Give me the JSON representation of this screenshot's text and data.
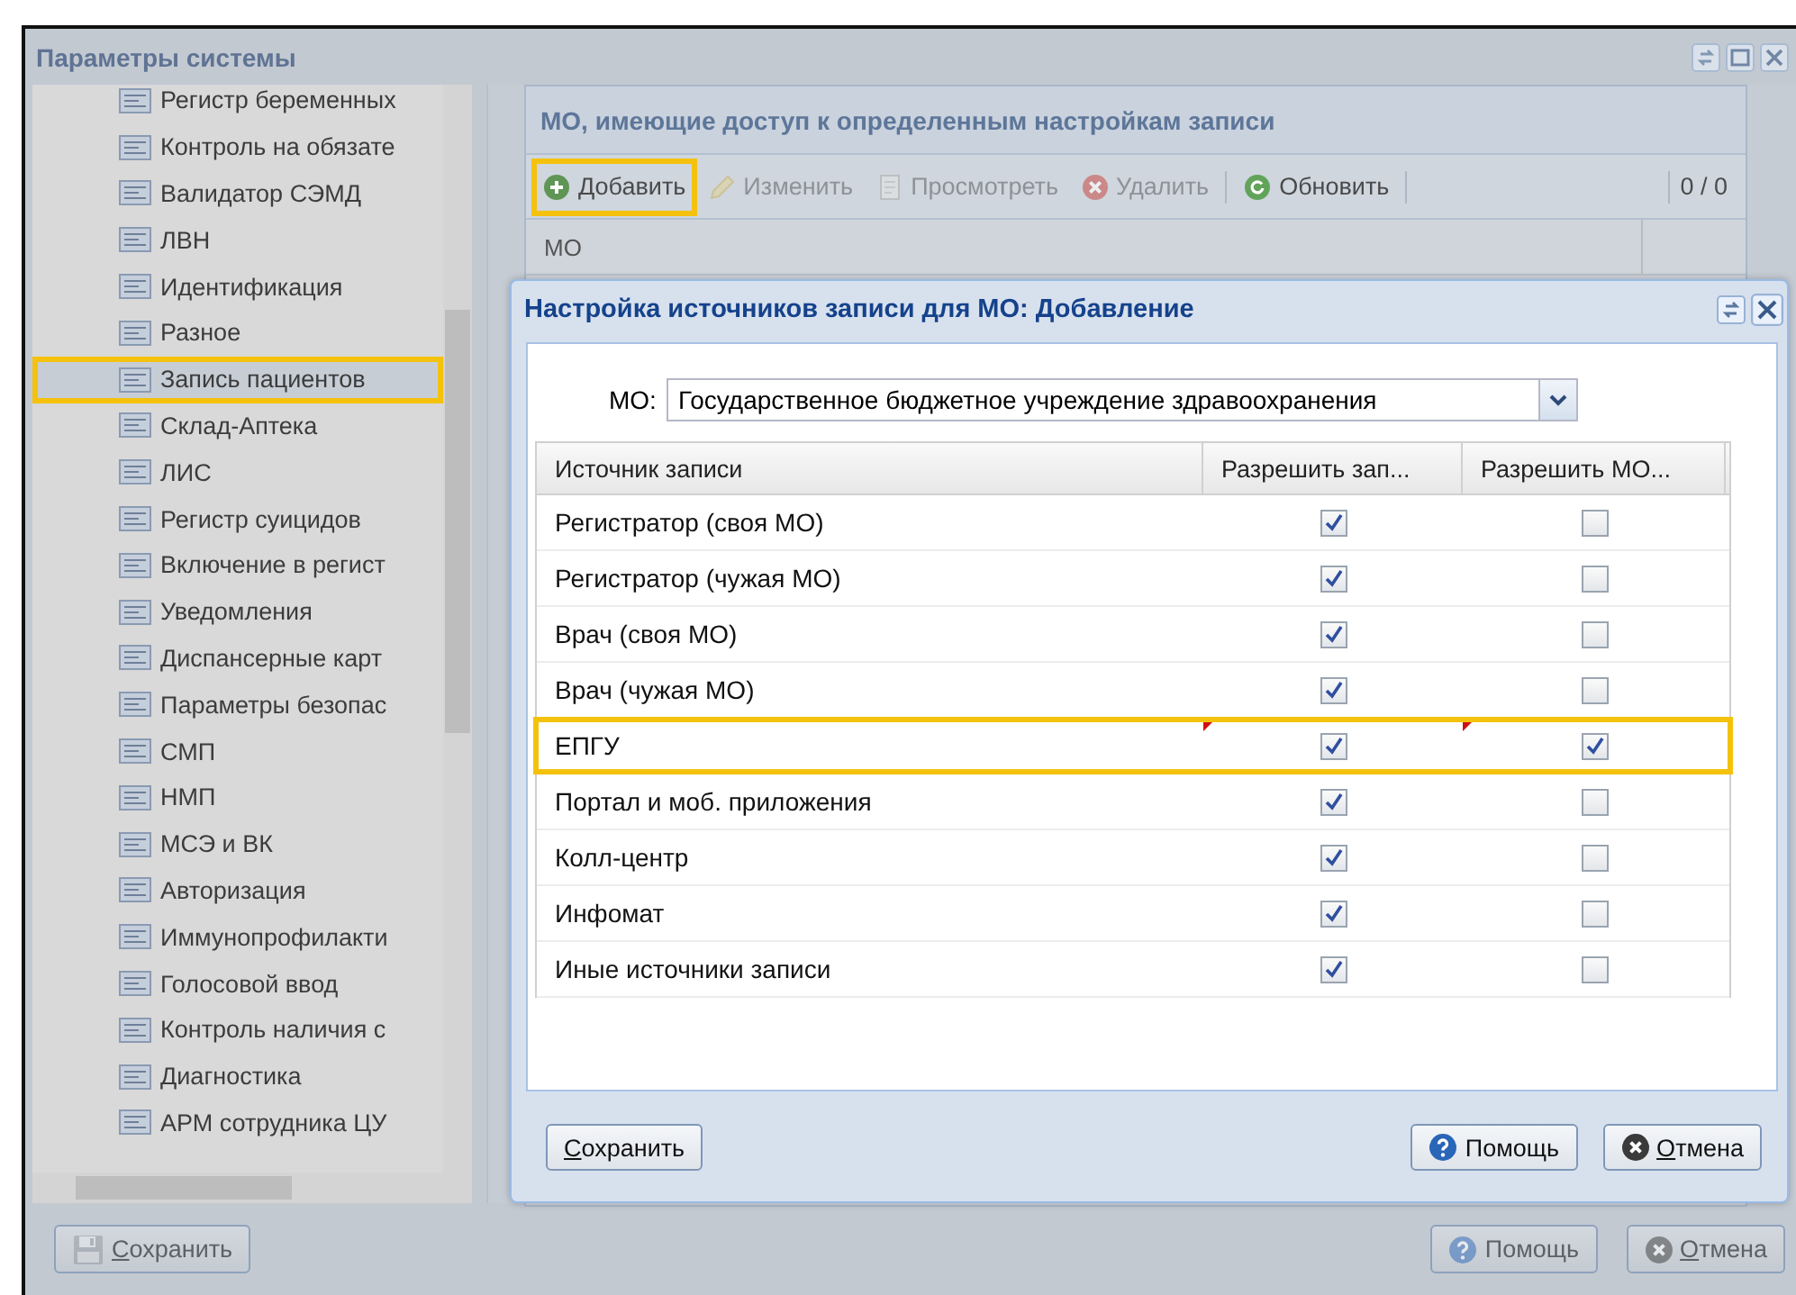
{
  "window": {
    "title": "Параметры системы"
  },
  "tree": {
    "items": [
      {
        "label": "Регистр беременных",
        "selected": false,
        "highlighted": false
      },
      {
        "label": "Контроль на обязате",
        "selected": false,
        "highlighted": false
      },
      {
        "label": "Валидатор СЭМД",
        "selected": false,
        "highlighted": false
      },
      {
        "label": "ЛВН",
        "selected": false,
        "highlighted": false
      },
      {
        "label": "Идентификация",
        "selected": false,
        "highlighted": false
      },
      {
        "label": "Разное",
        "selected": false,
        "highlighted": false
      },
      {
        "label": "Запись пациентов",
        "selected": true,
        "highlighted": true
      },
      {
        "label": "Склад-Аптека",
        "selected": false,
        "highlighted": false
      },
      {
        "label": "ЛИС",
        "selected": false,
        "highlighted": false
      },
      {
        "label": "Регистр суицидов",
        "selected": false,
        "highlighted": false
      },
      {
        "label": "Включение в регист",
        "selected": false,
        "highlighted": false
      },
      {
        "label": "Уведомления",
        "selected": false,
        "highlighted": false
      },
      {
        "label": "Диспансерные карт",
        "selected": false,
        "highlighted": false
      },
      {
        "label": "Параметры безопас",
        "selected": false,
        "highlighted": false
      },
      {
        "label": "СМП",
        "selected": false,
        "highlighted": false
      },
      {
        "label": "НМП",
        "selected": false,
        "highlighted": false
      },
      {
        "label": "МСЭ и ВК",
        "selected": false,
        "highlighted": false
      },
      {
        "label": "Авторизация",
        "selected": false,
        "highlighted": false
      },
      {
        "label": "Иммунопрофилакти",
        "selected": false,
        "highlighted": false
      },
      {
        "label": "Голосовой ввод",
        "selected": false,
        "highlighted": false
      },
      {
        "label": "Контроль наличия с",
        "selected": false,
        "highlighted": false
      },
      {
        "label": "Диагностика",
        "selected": false,
        "highlighted": false
      },
      {
        "label": "АРМ сотрудника ЦУ",
        "selected": false,
        "highlighted": false
      }
    ]
  },
  "grid": {
    "title": "МО, имеющие доступ к определенным настройкам записи",
    "toolbar": [
      {
        "kind": "add",
        "label": "Добавить",
        "disabled": false,
        "highlighted": true
      },
      {
        "kind": "edit",
        "label": "Изменить",
        "disabled": true,
        "highlighted": false
      },
      {
        "kind": "view",
        "label": "Просмотреть",
        "disabled": true,
        "highlighted": false
      },
      {
        "kind": "delete",
        "label": "Удалить",
        "disabled": true,
        "highlighted": false
      },
      {
        "kind": "refresh",
        "label": "Обновить",
        "disabled": false,
        "highlighted": false
      }
    ],
    "counter": "0 / 0",
    "columns": [
      "МО"
    ]
  },
  "footer": {
    "buttons": [
      {
        "kind": "save",
        "label": "Сохранить"
      },
      {
        "kind": "help",
        "label": "Помощь"
      },
      {
        "kind": "cancel",
        "label": "Отмена"
      }
    ]
  },
  "dialog": {
    "title": "Настройка источников записи для МО: Добавление",
    "mo_field": {
      "label": "МО:",
      "value": "Государственное бюджетное учреждение здравоохранения"
    },
    "columns": [
      "Источник записи",
      "Разрешить зап...",
      "Разрешить МО..."
    ],
    "rows": [
      {
        "source": "Регистратор (своя МО)",
        "allow_booking": true,
        "allow_mo": false,
        "modified": false,
        "highlighted": false
      },
      {
        "source": "Регистратор (чужая МО)",
        "allow_booking": true,
        "allow_mo": false,
        "modified": false,
        "highlighted": false
      },
      {
        "source": "Врач (своя МО)",
        "allow_booking": true,
        "allow_mo": false,
        "modified": false,
        "highlighted": false
      },
      {
        "source": "Врач (чужая МО)",
        "allow_booking": true,
        "allow_mo": false,
        "modified": false,
        "highlighted": false
      },
      {
        "source": "ЕПГУ",
        "allow_booking": true,
        "allow_mo": true,
        "modified": true,
        "highlighted": true
      },
      {
        "source": "Портал и моб. приложения",
        "allow_booking": true,
        "allow_mo": false,
        "modified": false,
        "highlighted": false
      },
      {
        "source": "Колл-центр",
        "allow_booking": true,
        "allow_mo": false,
        "modified": false,
        "highlighted": false
      },
      {
        "source": "Инфомат",
        "allow_booking": true,
        "allow_mo": false,
        "modified": false,
        "highlighted": false
      },
      {
        "source": "Иные источники записи",
        "allow_booking": true,
        "allow_mo": false,
        "modified": false,
        "highlighted": false
      }
    ],
    "buttons": [
      {
        "kind": "submit",
        "label": "Сохранить"
      },
      {
        "kind": "help",
        "label": "Помощь"
      },
      {
        "kind": "cancel",
        "label": "Отмена"
      }
    ]
  }
}
